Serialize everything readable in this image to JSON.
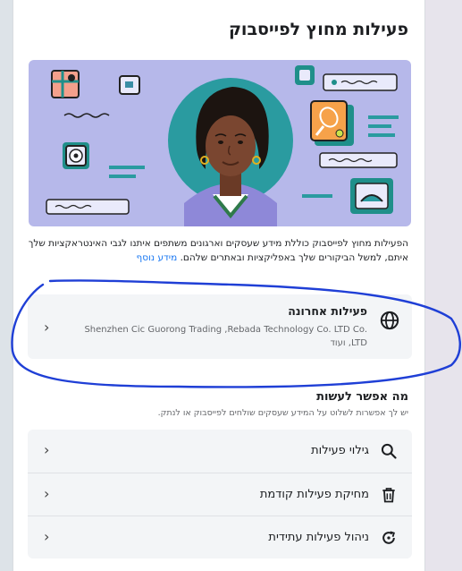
{
  "header": {
    "title": "פעילות מחוץ לפייסבוק"
  },
  "hero": {
    "illustration-icon": "person-portrait-with-app-icons"
  },
  "intro": {
    "text": "הפעילות מחוץ לפייסבוק כוללת מידע שעסקים וארגונים משתפים איתנו לגבי האינטראקציות שלך איתם, למשל הביקורים שלך באפליקציות ובאתרים שלהם.",
    "learn_more": "מידע נוסף"
  },
  "recent_activity": {
    "icon": "globe-icon",
    "label": "פעילות אחרונה",
    "detail": "Shenzhen Cic Guorong Trading ,Rebada Technology Co. LTD Co. LTD, ועוד"
  },
  "options": {
    "heading": "מה אפשר לעשות",
    "subheading": "יש לך אפשרות לשלוט על המידע שעסקים שולחים לפייסבוק או לנתק.",
    "items": [
      {
        "label": "גילוי פעילות",
        "icon": "search-icon"
      },
      {
        "label": "מחיקת פעילות קודמת",
        "icon": "trash-icon"
      },
      {
        "label": "ניהול פעילות עתידית",
        "icon": "refresh-icon"
      }
    ]
  },
  "colors": {
    "accent_link": "#1877f2",
    "hero_background": "#b6b8ea",
    "annotation_ink": "#1f3fd6"
  }
}
